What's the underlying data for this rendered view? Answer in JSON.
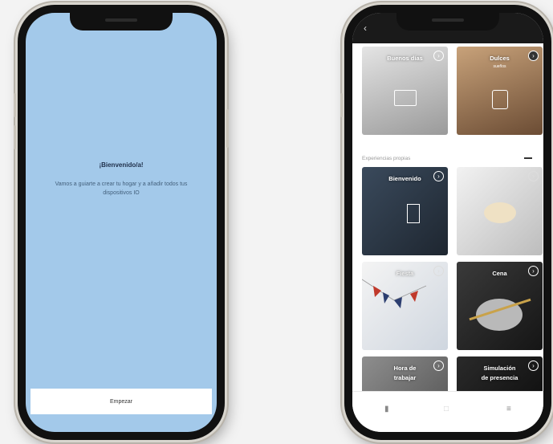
{
  "left_phone": {
    "title": "¡Bienvenido/a!",
    "message": "Vamos a guiarte a crear tu hogar y a añadir todos tus dispositivos IO",
    "start_button": "Empezar"
  },
  "right_phone": {
    "top_tiles": [
      {
        "label": "Buenos días"
      },
      {
        "label": "Dulces",
        "sub": "sueños"
      }
    ],
    "section_title": "Experiencias propias",
    "grid_tiles": [
      {
        "label": "Bienvenido"
      },
      {
        "label": ""
      },
      {
        "label": "Fiesta"
      },
      {
        "label": "Cena"
      },
      {
        "label": "Hora de",
        "label2": "trabajar"
      },
      {
        "label": "Simulación",
        "label2": "de presencia"
      }
    ],
    "nav_icons": [
      "device-icon",
      "home-icon",
      "menu-icon"
    ]
  }
}
